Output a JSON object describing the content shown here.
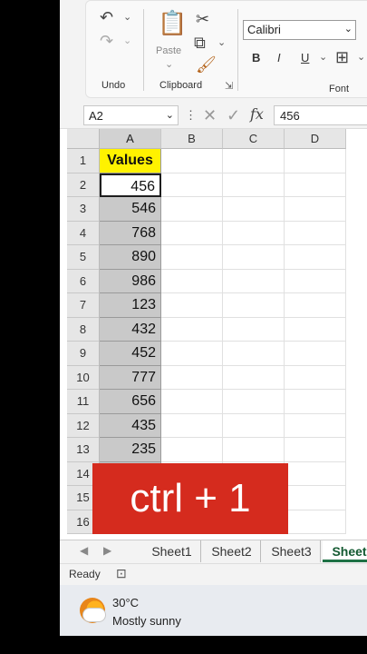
{
  "ribbon": {
    "undo_label": "Undo",
    "clipboard_label": "Clipboard",
    "paste_label": "Paste",
    "font_label": "Font",
    "font_name": "Calibri",
    "bold_label": "B",
    "italic_label": "I",
    "underline_label": "U"
  },
  "formula_bar": {
    "name_box": "A2",
    "fx_label": "fx",
    "value": "456"
  },
  "sheet": {
    "columns": [
      "A",
      "B",
      "C",
      "D"
    ],
    "rows": [
      "1",
      "2",
      "3",
      "4",
      "5",
      "6",
      "7",
      "8",
      "9",
      "10",
      "11",
      "12",
      "13",
      "14",
      "15",
      "16"
    ],
    "header_text": "Values",
    "values": [
      "456",
      "546",
      "768",
      "890",
      "986",
      "123",
      "432",
      "452",
      "777",
      "656",
      "435",
      "235"
    ]
  },
  "banner": {
    "text": "ctrl + 1"
  },
  "tabs": [
    "Sheet1",
    "Sheet2",
    "Sheet3",
    "Sheet"
  ],
  "status": {
    "ready": "Ready"
  },
  "weather": {
    "temp": "30°C",
    "desc": "Mostly sunny"
  },
  "colors": {
    "header_fill": "#fff200",
    "banner_fill": "#d52b1e",
    "selected_fill": "#c9c9c9"
  }
}
